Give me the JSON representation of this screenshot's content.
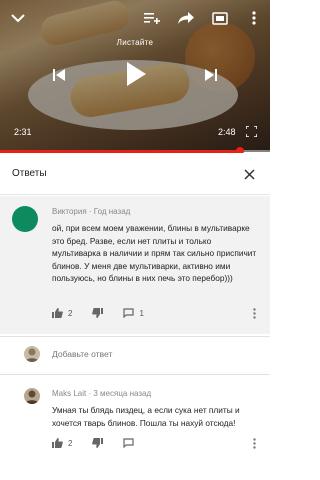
{
  "player": {
    "swipe_hint": "Листайте",
    "current_time": "2:31",
    "duration": "2:48",
    "progress": 0.89
  },
  "panel": {
    "title": "Ответы"
  },
  "comment": {
    "author": "Виктория",
    "time": "Год назад",
    "text": "ой, при всем моем уважении, блины в мультиварке это бред. Разве, если нет плиты и только мультиварка в наличии и прям так сильно приспичит блинов. У меня две мультиварки, активно ими пользуюсь, но блины в них печь это перебор)))",
    "likes": "2",
    "replies": "1"
  },
  "add_reply": {
    "placeholder": "Добавьте ответ"
  },
  "reply": {
    "author": "Maks Lait",
    "time": "3 месяца назад",
    "text": "Умная ты блядь пиздец, а если сука нет плиты и хочется тварь блинов. Пошла ты нахуй отсюда!",
    "likes": "2"
  },
  "colors": {
    "accent_red": "#e62117",
    "avatar_green": "#0d8a5e",
    "thread_bg": "#f2f2f2"
  }
}
